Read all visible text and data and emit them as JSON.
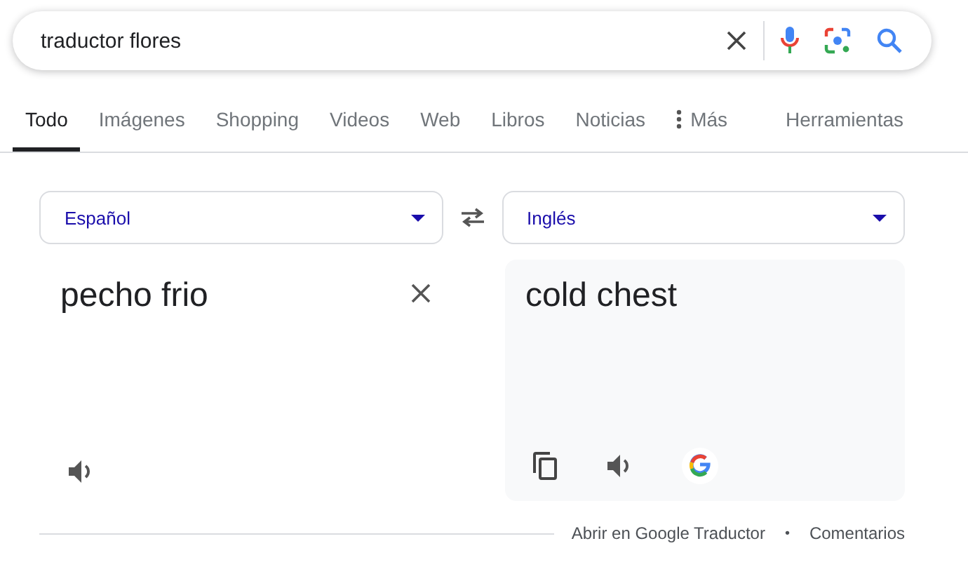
{
  "search": {
    "value": "traductor flores"
  },
  "tabs": [
    {
      "label": "Todo",
      "selected": true
    },
    {
      "label": "Imágenes",
      "selected": false
    },
    {
      "label": "Shopping",
      "selected": false
    },
    {
      "label": "Videos",
      "selected": false
    },
    {
      "label": "Web",
      "selected": false
    },
    {
      "label": "Libros",
      "selected": false
    },
    {
      "label": "Noticias",
      "selected": false
    },
    {
      "label": "Más",
      "selected": false,
      "kind": "more"
    }
  ],
  "tools": "Herramientas",
  "translator": {
    "source_language": "Español",
    "target_language": "Inglés",
    "source_text": "pecho frio",
    "target_text": "cold chest"
  },
  "footer": {
    "link": "Abrir en Google Traductor",
    "separator": "•",
    "feedback": "Comentarios"
  }
}
